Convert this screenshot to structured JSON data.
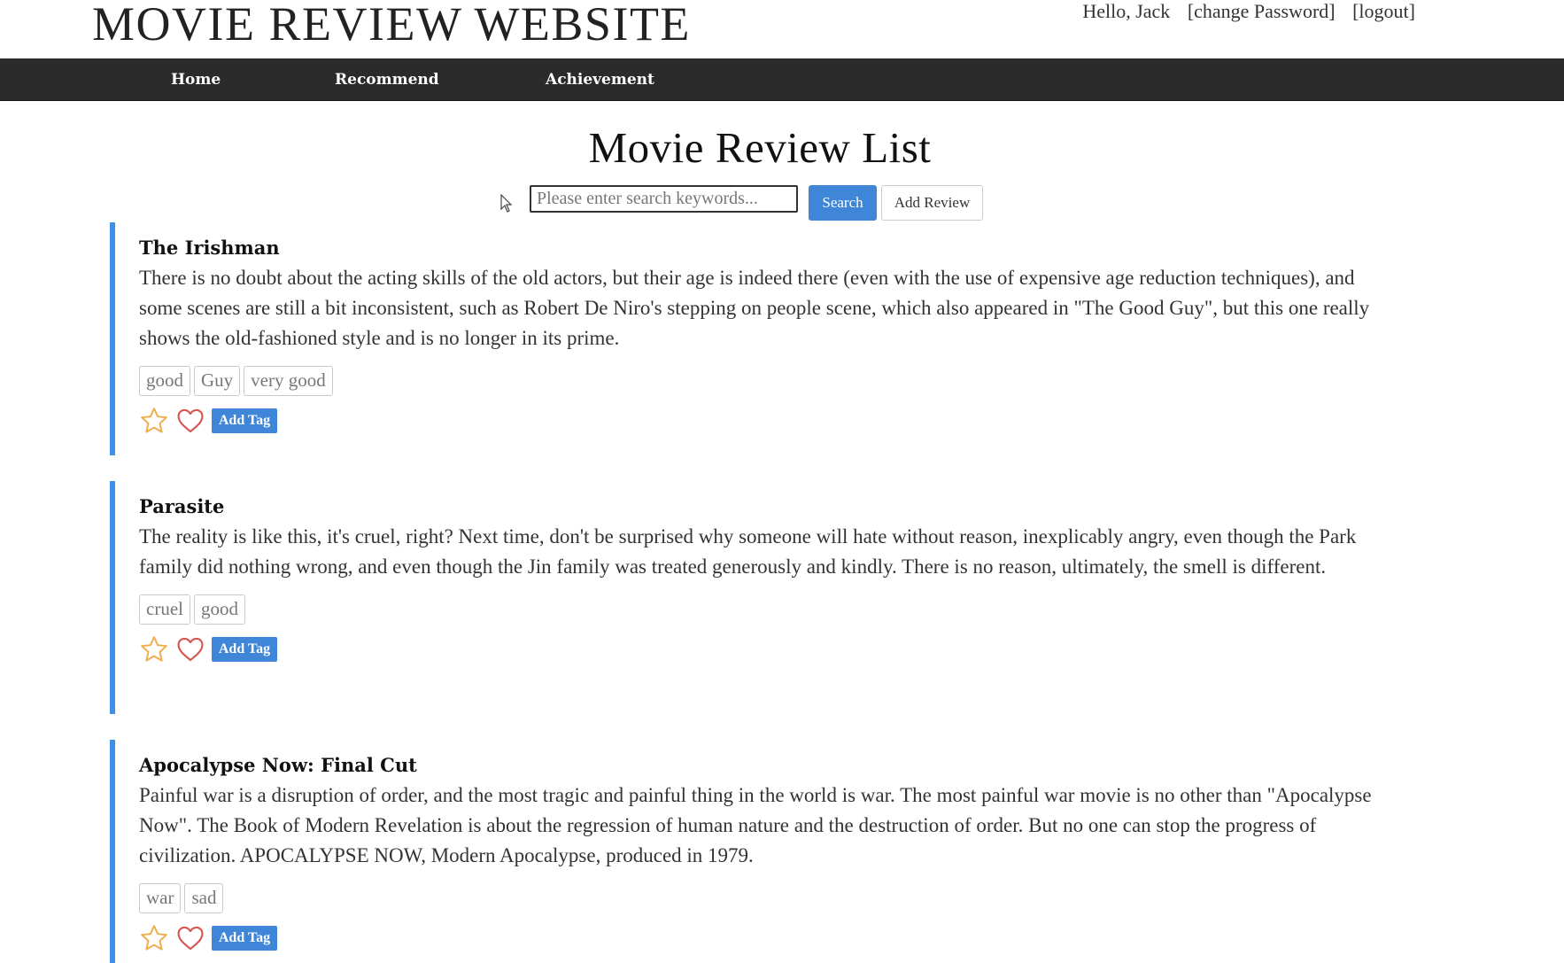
{
  "site": {
    "title": "MOVIE REVIEW WEBSITE",
    "greeting": "Hello, Jack",
    "change_password": "[change Password]",
    "logout": "[logout]"
  },
  "nav": {
    "items": [
      {
        "label": "Home"
      },
      {
        "label": "Recommend"
      },
      {
        "label": "Achievement"
      }
    ]
  },
  "main": {
    "title": "Movie Review List",
    "search": {
      "placeholder": "Please enter search keywords...",
      "value": "",
      "button_label": "Search"
    },
    "add_review_label": "Add Review"
  },
  "reviews": [
    {
      "title": "The Irishman",
      "body": "There is no doubt about the acting skills of the old actors, but their age is indeed there (even with the use of expensive age reduction techniques), and some scenes are still a bit inconsistent, such as Robert De Niro's stepping on people scene, which also appeared in \"The Good Guy\", but this one really shows the old-fashioned style and is no longer in its prime.",
      "tags": [
        "good",
        "Guy",
        "very good"
      ],
      "add_tag_label": "Add Tag"
    },
    {
      "title": "Parasite",
      "body": "The reality is like this, it's cruel, right? Next time, don't be surprised why someone will hate without reason, inexplicably angry, even though the Park family did nothing wrong, and even though the Jin family was treated generously and kindly. There is no reason, ultimately, the smell is different.",
      "tags": [
        "cruel",
        "good"
      ],
      "add_tag_label": "Add Tag"
    },
    {
      "title": "Apocalypse Now: Final Cut",
      "body": "Painful war is a disruption of order, and the most tragic and painful thing in the world is war. The most painful war movie is no other than \"Apocalypse Now\". The Book of Modern Revelation is about the regression of human nature and the destruction of order. But no one can stop the progress of civilization. APOCALYPSE NOW, Modern Apocalypse, produced in 1979.",
      "tags": [
        "war",
        "sad"
      ],
      "add_tag_label": "Add Tag"
    }
  ],
  "icons": {
    "star": "star-icon",
    "heart": "heart-icon"
  },
  "colors": {
    "navbar": "#2b2b2b",
    "accent_blue": "#3f86d8",
    "review_border": "#3f8fe8",
    "star": "#f0ad4e",
    "heart": "#d9534f"
  }
}
